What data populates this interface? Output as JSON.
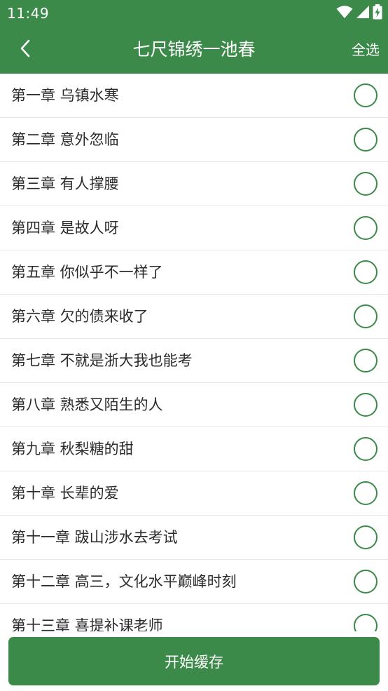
{
  "status_bar": {
    "time": "11:49",
    "icons": [
      "wifi-icon",
      "cell-signal-icon",
      "battery-icon"
    ]
  },
  "app_bar": {
    "back_icon": "chevron-left-icon",
    "title": "七尺锦绣一池春",
    "select_all_label": "全选"
  },
  "chapters": [
    "第一章 乌镇水寒",
    "第二章 意外忽临",
    "第三章 有人撑腰",
    "第四章 是故人呀",
    "第五章 你似乎不一样了",
    "第六章 欠的债来收了",
    "第七章 不就是浙大我也能考",
    "第八章 熟悉又陌生的人",
    "第九章 秋梨糖的甜",
    "第十章 长辈的爱",
    "第十一章 跋山涉水去考试",
    "第十二章 高三，文化水平巅峰时刻",
    "第十三章 喜提补课老师"
  ],
  "footer": {
    "start_button_label": "开始缓存"
  },
  "colors": {
    "primary": "#3c8a4a",
    "divider": "#e6e6e6",
    "text": "#2b2b2b"
  }
}
